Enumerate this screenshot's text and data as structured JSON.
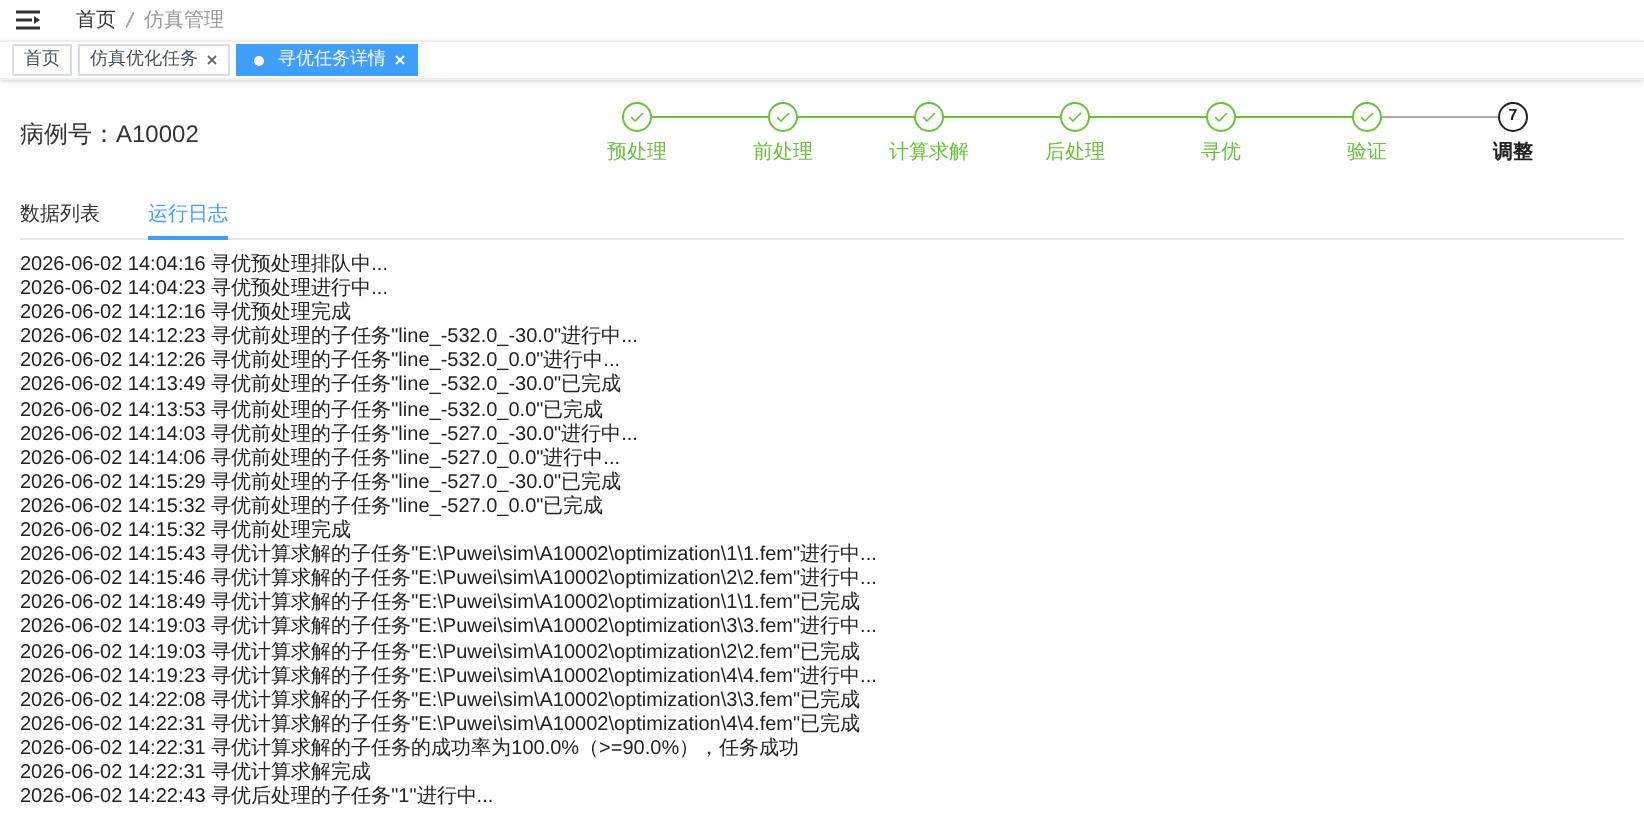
{
  "breadcrumb": [
    "首页",
    "仿真管理"
  ],
  "page_tabs": [
    {
      "label": "首页",
      "selected": false,
      "closable": false
    },
    {
      "label": "仿真优化任务",
      "selected": false,
      "closable": true
    },
    {
      "label": "寻优任务详情",
      "selected": true,
      "closable": true
    }
  ],
  "case_label": "病例号：A10002",
  "steps": [
    {
      "label": "预处理",
      "done": true
    },
    {
      "label": "前处理",
      "done": true
    },
    {
      "label": "计算求解",
      "done": true
    },
    {
      "label": "后处理",
      "done": true
    },
    {
      "label": "寻优",
      "done": true
    },
    {
      "label": "验证",
      "done": true
    },
    {
      "label": "调整",
      "done": false,
      "number": "7"
    }
  ],
  "content_tabs": [
    {
      "label": "数据列表",
      "selected": false
    },
    {
      "label": "运行日志",
      "selected": true
    }
  ],
  "log": [
    "2026-06-02 14:04:16 寻优预处理排队中...",
    "2026-06-02 14:04:23 寻优预处理进行中...",
    "2026-06-02 14:12:16 寻优预处理完成",
    "2026-06-02 14:12:23 寻优前处理的子任务\"line_-532.0_-30.0\"进行中...",
    "2026-06-02 14:12:26 寻优前处理的子任务\"line_-532.0_0.0\"进行中...",
    "2026-06-02 14:13:49 寻优前处理的子任务\"line_-532.0_-30.0\"已完成",
    "2026-06-02 14:13:53 寻优前处理的子任务\"line_-532.0_0.0\"已完成",
    "2026-06-02 14:14:03 寻优前处理的子任务\"line_-527.0_-30.0\"进行中...",
    "2026-06-02 14:14:06 寻优前处理的子任务\"line_-527.0_0.0\"进行中...",
    "2026-06-02 14:15:29 寻优前处理的子任务\"line_-527.0_-30.0\"已完成",
    "2026-06-02 14:15:32 寻优前处理的子任务\"line_-527.0_0.0\"已完成",
    "2026-06-02 14:15:32 寻优前处理完成",
    "2026-06-02 14:15:43 寻优计算求解的子任务\"E:\\Puwei\\sim\\A10002\\optimization\\1\\1.fem\"进行中...",
    "2026-06-02 14:15:46 寻优计算求解的子任务\"E:\\Puwei\\sim\\A10002\\optimization\\2\\2.fem\"进行中...",
    "2026-06-02 14:18:49 寻优计算求解的子任务\"E:\\Puwei\\sim\\A10002\\optimization\\1\\1.fem\"已完成",
    "2026-06-02 14:19:03 寻优计算求解的子任务\"E:\\Puwei\\sim\\A10002\\optimization\\3\\3.fem\"进行中...",
    "2026-06-02 14:19:03 寻优计算求解的子任务\"E:\\Puwei\\sim\\A10002\\optimization\\2\\2.fem\"已完成",
    "2026-06-02 14:19:23 寻优计算求解的子任务\"E:\\Puwei\\sim\\A10002\\optimization\\4\\4.fem\"进行中...",
    "2026-06-02 14:22:08 寻优计算求解的子任务\"E:\\Puwei\\sim\\A10002\\optimization\\3\\3.fem\"已完成",
    "2026-06-02 14:22:31 寻优计算求解的子任务\"E:\\Puwei\\sim\\A10002\\optimization\\4\\4.fem\"已完成",
    "2026-06-02 14:22:31 寻优计算求解的子任务的成功率为100.0%（>=90.0%），任务成功",
    "2026-06-02 14:22:31 寻优计算求解完成",
    "2026-06-02 14:22:43 寻优后处理的子任务\"1\"进行中..."
  ]
}
